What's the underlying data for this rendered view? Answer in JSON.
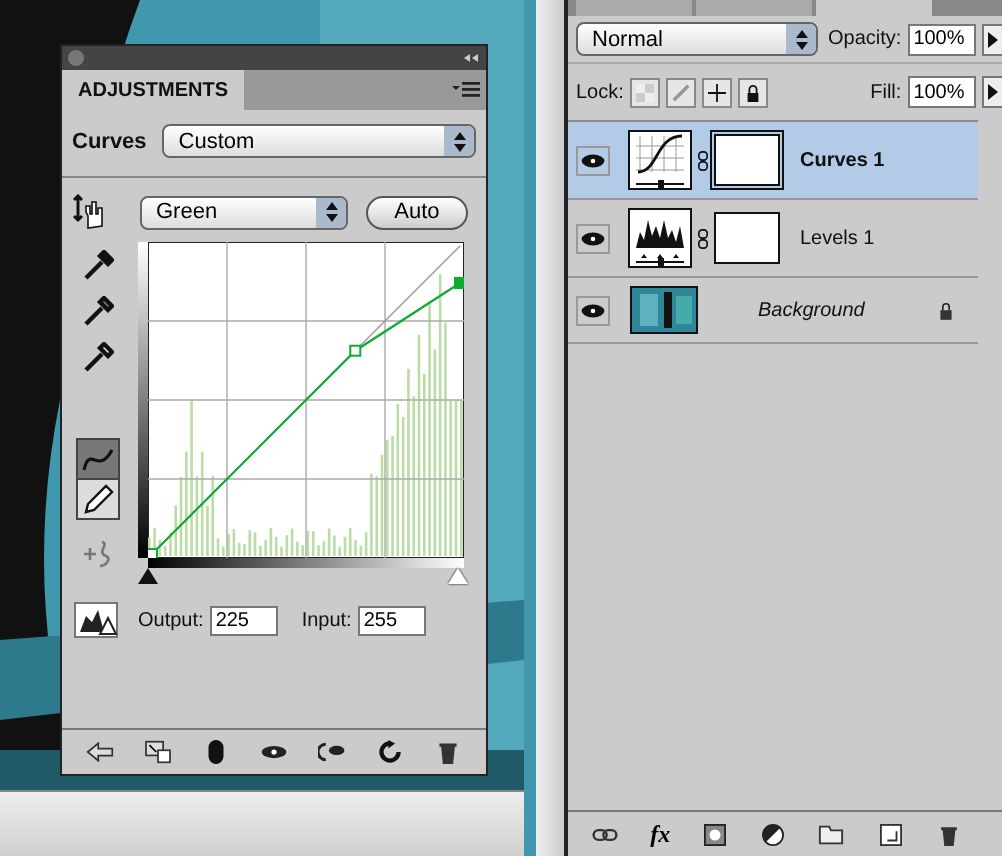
{
  "adjustments": {
    "tab": "ADJUSTMENTS",
    "preset_label": "Curves",
    "preset": "Custom",
    "channel": "Green",
    "auto_button": "Auto",
    "tools": [
      {
        "kind": "curve",
        "selected": true
      },
      {
        "kind": "pencil",
        "selected": false
      }
    ],
    "output_label": "Output:",
    "output": "225",
    "input_label": "Input:",
    "input": "255"
  },
  "layers": {
    "tabs": [
      {
        "selected": false
      },
      {
        "selected": false
      },
      {
        "selected": true
      }
    ],
    "fx_button": "fx",
    "blend_mode": "Normal",
    "opacity_label": "Opacity:",
    "opacity": "100%",
    "lock_label": "Lock:",
    "fill_label": "Fill:",
    "fill": "100%",
    "items": [
      {
        "kind": "curves",
        "name": "Curves 1",
        "selected": true,
        "visible": true,
        "locked": false
      },
      {
        "kind": "levels",
        "name": "Levels 1",
        "selected": false,
        "visible": true,
        "locked": false
      },
      {
        "name": "Background",
        "selected": false,
        "visible": true,
        "locked": true
      }
    ]
  }
}
